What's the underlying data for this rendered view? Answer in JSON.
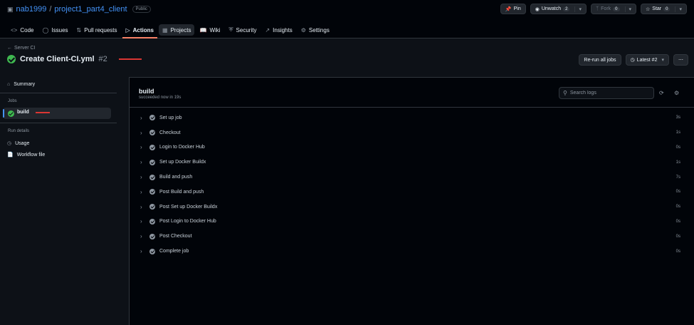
{
  "repo": {
    "owner": "nab1999",
    "separator": "/",
    "name": "project1_part4_client",
    "visibility": "Public"
  },
  "header_buttons": {
    "pin": "Pin",
    "unwatch": "Unwatch",
    "unwatch_count": "2",
    "fork": "Fork",
    "fork_count": "0",
    "star": "Star",
    "star_count": "0"
  },
  "tabs": [
    {
      "label": "Code",
      "icon": "code-icon"
    },
    {
      "label": "Issues",
      "icon": "issue-icon"
    },
    {
      "label": "Pull requests",
      "icon": "pull-request-icon"
    },
    {
      "label": "Actions",
      "icon": "play-icon"
    },
    {
      "label": "Projects",
      "icon": "table-icon"
    },
    {
      "label": "Wiki",
      "icon": "book-icon"
    },
    {
      "label": "Security",
      "icon": "shield-icon"
    },
    {
      "label": "Insights",
      "icon": "graph-icon"
    },
    {
      "label": "Settings",
      "icon": "gear-icon"
    }
  ],
  "run": {
    "back_label": "Server CI",
    "title": "Create Client-CI.yml",
    "number": "#2",
    "rerun_label": "Re-run all jobs",
    "latest_label": "Latest #2"
  },
  "sidebar": {
    "summary": "Summary",
    "jobs_heading": "Jobs",
    "job": "build",
    "run_details_heading": "Run details",
    "usage": "Usage",
    "workflow_file": "Workflow file"
  },
  "job": {
    "title": "build",
    "subtitle": "succeeded now in 19s",
    "search_placeholder": "Search logs"
  },
  "steps": [
    {
      "name": "Set up job",
      "duration": "3s"
    },
    {
      "name": "Checkout",
      "duration": "1s"
    },
    {
      "name": "Login to Docker Hub",
      "duration": "0s"
    },
    {
      "name": "Set up Docker Buildx",
      "duration": "1s"
    },
    {
      "name": "Build and push",
      "duration": "7s"
    },
    {
      "name": "Post Build and push",
      "duration": "0s"
    },
    {
      "name": "Post Set up Docker Buildx",
      "duration": "0s"
    },
    {
      "name": "Post Login to Docker Hub",
      "duration": "0s"
    },
    {
      "name": "Post Checkout",
      "duration": "0s"
    },
    {
      "name": "Complete job",
      "duration": "0s"
    }
  ],
  "colors": {
    "success": "#3fb950",
    "accent": "#4493f8",
    "active_tab_underline": "#f78166",
    "annotation_red": "#da3633"
  }
}
